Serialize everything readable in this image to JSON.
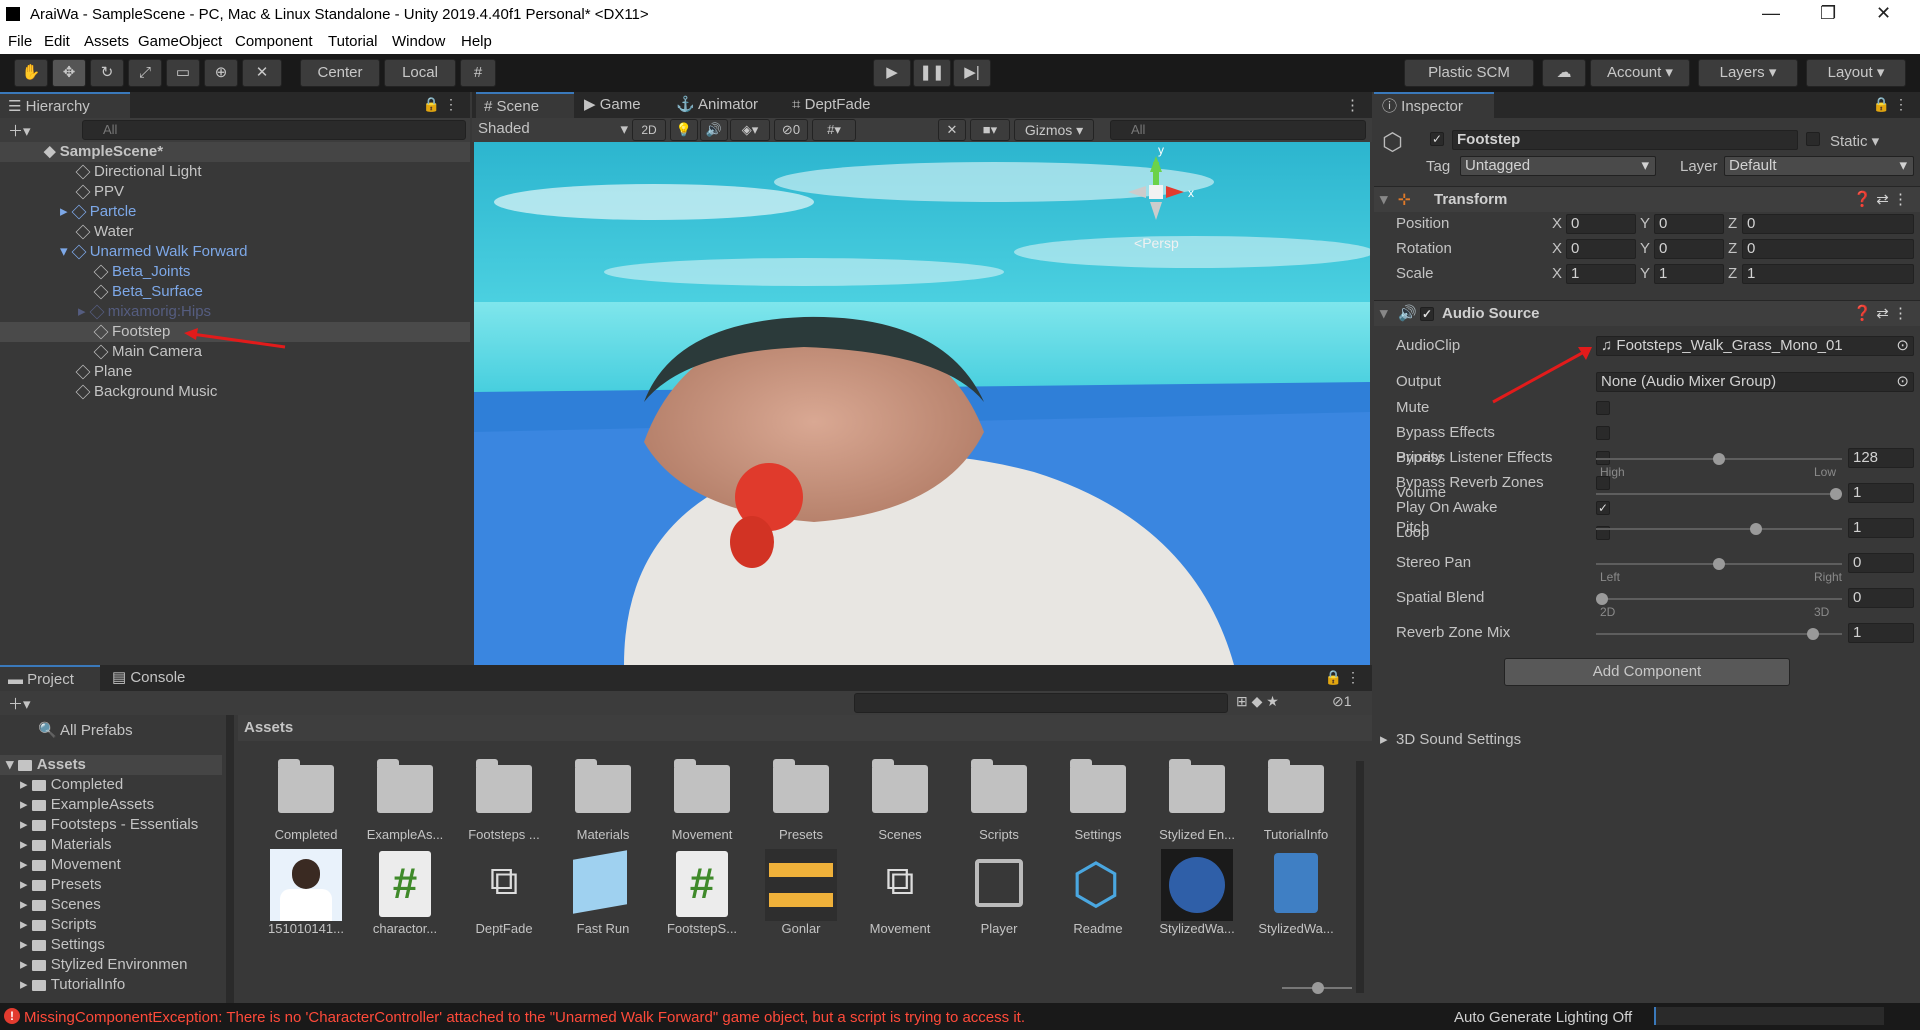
{
  "window": {
    "title": "AraiWa - SampleScene - PC, Mac & Linux Standalone - Unity 2019.4.40f1 Personal* <DX11>",
    "minimize": "—",
    "maximize": "❐",
    "close": "✕"
  },
  "menu": [
    "File",
    "Edit",
    "Assets",
    "GameObject",
    "Component",
    "Tutorial",
    "Window",
    "Help"
  ],
  "toolbar": {
    "center": "Center",
    "local": "Local",
    "plastic": "Plastic SCM",
    "account": "Account",
    "layers": "Layers",
    "layout": "Layout"
  },
  "hierarchy": {
    "tab": "Hierarchy",
    "search_placeholder": "All",
    "scene": "SampleScene*",
    "items": [
      "Directional Light",
      "PPV",
      "Partcle",
      "Water",
      "Unarmed Walk Forward",
      "Beta_Joints",
      "Beta_Surface",
      "mixamorig:Hips",
      "Footstep",
      "Main Camera",
      "Plane",
      "Background Music"
    ]
  },
  "scene": {
    "tabs": [
      "Scene",
      "Game",
      "Animator",
      "DeptFade"
    ],
    "shading": "Shaded",
    "mode2d": "2D",
    "layers_count": "0",
    "gizmos": "Gizmos",
    "search_placeholder": "All",
    "persp": "Persp",
    "axis_x": "x",
    "axis_y": "y"
  },
  "inspector": {
    "tab": "Inspector",
    "object_name": "Footstep",
    "static": "Static",
    "tag_label": "Tag",
    "tag": "Untagged",
    "layer_label": "Layer",
    "layer": "Default",
    "transform": {
      "title": "Transform",
      "rows": [
        {
          "label": "Position",
          "x": "0",
          "y": "0",
          "z": "0"
        },
        {
          "label": "Rotation",
          "x": "0",
          "y": "0",
          "z": "0"
        },
        {
          "label": "Scale",
          "x": "1",
          "y": "1",
          "z": "1"
        }
      ],
      "xl": "X",
      "yl": "Y",
      "zl": "Z"
    },
    "audio": {
      "title": "Audio Source",
      "audioclip_label": "AudioClip",
      "audioclip": "Footsteps_Walk_Grass_Mono_01",
      "output_label": "Output",
      "output": "None (Audio Mixer Group)",
      "checks": [
        {
          "label": "Mute",
          "on": false
        },
        {
          "label": "Bypass Effects",
          "on": false
        },
        {
          "label": "Bypass Listener Effects",
          "on": false
        },
        {
          "label": "Bypass Reverb Zones",
          "on": false
        },
        {
          "label": "Play On Awake",
          "on": true
        },
        {
          "label": "Loop",
          "on": false
        }
      ],
      "sliders": [
        {
          "label": "Priority",
          "value": "128",
          "pos": 0.5,
          "lo": "High",
          "hi": "Low"
        },
        {
          "label": "Volume",
          "value": "1",
          "pos": 1.0,
          "lo": "",
          "hi": ""
        },
        {
          "label": "Pitch",
          "value": "1",
          "pos": 0.66,
          "lo": "",
          "hi": ""
        },
        {
          "label": "Stereo Pan",
          "value": "0",
          "pos": 0.5,
          "lo": "Left",
          "hi": "Right"
        },
        {
          "label": "Spatial Blend",
          "value": "0",
          "pos": 0.0,
          "lo": "2D",
          "hi": "3D"
        },
        {
          "label": "Reverb Zone Mix",
          "value": "1",
          "pos": 0.9,
          "lo": "",
          "hi": ""
        }
      ],
      "sound3d": "3D Sound Settings"
    },
    "add_component": "Add Component"
  },
  "project": {
    "tabs": [
      "Project",
      "Console"
    ],
    "all_prefabs": "All Prefabs",
    "root": "Assets",
    "breadcrumb": "Assets",
    "hidden_count": "1",
    "tree": [
      "Completed",
      "ExampleAssets",
      "Footsteps - Essentials",
      "Materials",
      "Movement",
      "Presets",
      "Scenes",
      "Scripts",
      "Settings",
      "Stylized Environmen",
      "TutorialInfo"
    ],
    "folders": [
      "Completed",
      "ExampleAs...",
      "Footsteps ...",
      "Materials",
      "Movement",
      "Presets",
      "Scenes",
      "Scripts",
      "Settings",
      "Stylized En...",
      "TutorialInfo"
    ],
    "assets": [
      "151010141...",
      "charactor...",
      "DeptFade",
      "Fast Run",
      "FootstepS...",
      "Gonlar",
      "Movement",
      "Player",
      "Readme",
      "StylizedWa...",
      "StylizedWa..."
    ]
  },
  "status": {
    "error": "MissingComponentException: There is no 'CharacterController' attached to the \"Unarmed Walk Forward\" game object, but a script is trying to access it.",
    "lighting": "Auto Generate Lighting Off"
  },
  "colors": {
    "accent": "#3a79bb",
    "error": "#ff3b30",
    "prefab": "#7da8e8"
  }
}
